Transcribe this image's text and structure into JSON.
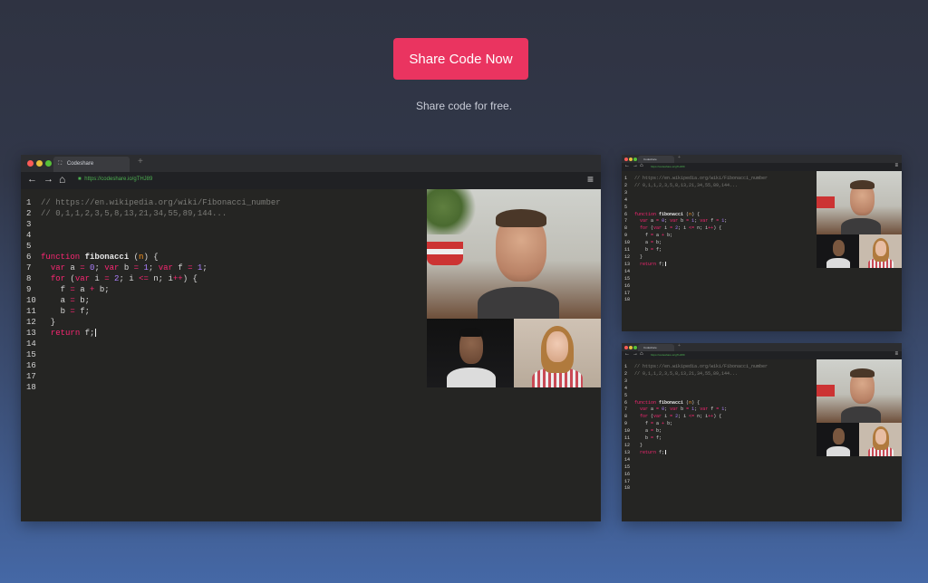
{
  "hero": {
    "cta_label": "Share Code Now",
    "tagline": "Share code for free."
  },
  "browser": {
    "tab_title": "Codeshare",
    "new_tab": "+",
    "url": "https://codeshare.io/gTHJ89",
    "nav_back": "←",
    "nav_forward": "→",
    "nav_home": "⌂",
    "menu": "≡",
    "lock": "🔒"
  },
  "code_lines": [
    {
      "n": "1",
      "parts": [
        {
          "t": "// https://en.wikipedia.org/wiki/Fibonacci_number",
          "c": "cm"
        }
      ]
    },
    {
      "n": "2",
      "parts": [
        {
          "t": "// 0,1,1,2,3,5,8,13,21,34,55,89,144...",
          "c": "cm"
        }
      ]
    },
    {
      "n": "3",
      "parts": []
    },
    {
      "n": "4",
      "parts": []
    },
    {
      "n": "5",
      "parts": []
    },
    {
      "n": "6",
      "parts": [
        {
          "t": "function",
          "c": "kw"
        },
        {
          "t": " "
        },
        {
          "t": "fibonacci",
          "c": "fn"
        },
        {
          "t": " ("
        },
        {
          "t": "n",
          "c": "pr"
        },
        {
          "t": ") {"
        }
      ]
    },
    {
      "n": "7",
      "parts": [
        {
          "t": "  "
        },
        {
          "t": "var",
          "c": "kw"
        },
        {
          "t": " a "
        },
        {
          "t": "=",
          "c": "kw"
        },
        {
          "t": " "
        },
        {
          "t": "0",
          "c": "nm"
        },
        {
          "t": "; "
        },
        {
          "t": "var",
          "c": "kw"
        },
        {
          "t": " b "
        },
        {
          "t": "=",
          "c": "kw"
        },
        {
          "t": " "
        },
        {
          "t": "1",
          "c": "nm"
        },
        {
          "t": "; "
        },
        {
          "t": "var",
          "c": "kw"
        },
        {
          "t": " f "
        },
        {
          "t": "=",
          "c": "kw"
        },
        {
          "t": " "
        },
        {
          "t": "1",
          "c": "nm"
        },
        {
          "t": ";"
        }
      ]
    },
    {
      "n": "8",
      "parts": [
        {
          "t": "  "
        },
        {
          "t": "for",
          "c": "kw"
        },
        {
          "t": " ("
        },
        {
          "t": "var",
          "c": "kw"
        },
        {
          "t": " i "
        },
        {
          "t": "=",
          "c": "kw"
        },
        {
          "t": " "
        },
        {
          "t": "2",
          "c": "nm"
        },
        {
          "t": "; i "
        },
        {
          "t": "<=",
          "c": "kw"
        },
        {
          "t": " n; i"
        },
        {
          "t": "++",
          "c": "kw"
        },
        {
          "t": ") {"
        }
      ]
    },
    {
      "n": "9",
      "parts": [
        {
          "t": "    f "
        },
        {
          "t": "=",
          "c": "kw"
        },
        {
          "t": " a "
        },
        {
          "t": "+",
          "c": "kw"
        },
        {
          "t": " b;"
        }
      ]
    },
    {
      "n": "10",
      "parts": [
        {
          "t": "    a "
        },
        {
          "t": "=",
          "c": "kw"
        },
        {
          "t": " b;"
        }
      ]
    },
    {
      "n": "11",
      "parts": [
        {
          "t": "    b "
        },
        {
          "t": "=",
          "c": "kw"
        },
        {
          "t": " f;"
        }
      ]
    },
    {
      "n": "12",
      "parts": [
        {
          "t": "  }"
        }
      ]
    },
    {
      "n": "13",
      "parts": [
        {
          "t": "  "
        },
        {
          "t": "return",
          "c": "kw"
        },
        {
          "t": " f;"
        },
        {
          "t": "",
          "c": "cursor"
        }
      ]
    },
    {
      "n": "14",
      "parts": []
    },
    {
      "n": "15",
      "parts": []
    },
    {
      "n": "16",
      "parts": []
    },
    {
      "n": "17",
      "parts": []
    },
    {
      "n": "18",
      "parts": []
    }
  ],
  "colors": {
    "accent": "#ea3460",
    "editor_bg": "#252523",
    "keyword": "#f92672",
    "number": "#ae81ff",
    "param": "#fd971f",
    "comment": "#7c7c78"
  }
}
